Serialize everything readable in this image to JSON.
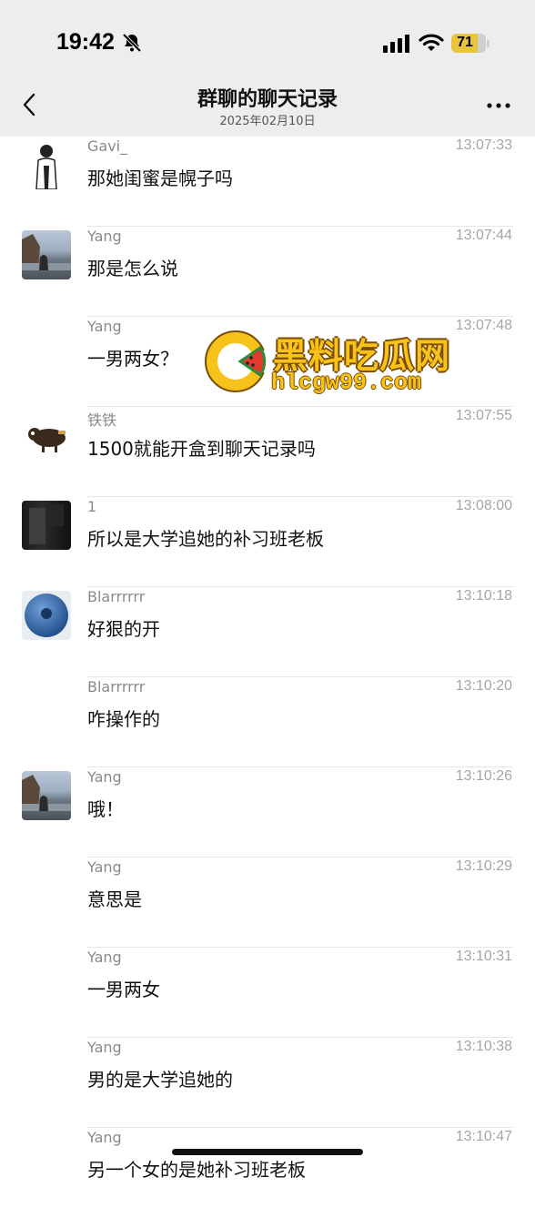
{
  "status_bar": {
    "time": "19:42",
    "battery": "71"
  },
  "header": {
    "title": "群聊的聊天记录",
    "date": "2025年02月10日"
  },
  "watermark": {
    "title": "黑料吃瓜网",
    "url": "hlcgw99.com"
  },
  "messages": [
    {
      "name": "Gavi_",
      "time": "13:07:33",
      "text": "那她闺蜜是幌子吗",
      "avatar": "gavi"
    },
    {
      "name": "Yang",
      "time": "13:07:44",
      "text": "那是怎么说",
      "avatar": "yang"
    },
    {
      "name": "Yang",
      "time": "13:07:48",
      "text": "一男两女？",
      "avatar": ""
    },
    {
      "name": "铁铁",
      "time": "13:07:55",
      "text": "1500就能开盒到聊天记录吗",
      "avatar": "tietie"
    },
    {
      "name": "1",
      "time": "13:08:00",
      "text": "所以是大学追她的补习班老板",
      "avatar": "one"
    },
    {
      "name": "Blarrrrrr",
      "time": "13:10:18",
      "text": "好狠的开",
      "avatar": "blue"
    },
    {
      "name": "Blarrrrrr",
      "time": "13:10:20",
      "text": "咋操作的",
      "avatar": ""
    },
    {
      "name": "Yang",
      "time": "13:10:26",
      "text": "哦！",
      "avatar": "yang"
    },
    {
      "name": "Yang",
      "time": "13:10:29",
      "text": "意思是",
      "avatar": ""
    },
    {
      "name": "Yang",
      "time": "13:10:31",
      "text": "一男两女",
      "avatar": ""
    },
    {
      "name": "Yang",
      "time": "13:10:38",
      "text": "男的是大学追她的",
      "avatar": ""
    },
    {
      "name": "Yang",
      "time": "13:10:47",
      "text": "另一个女的是她补习班老板",
      "avatar": ""
    }
  ]
}
